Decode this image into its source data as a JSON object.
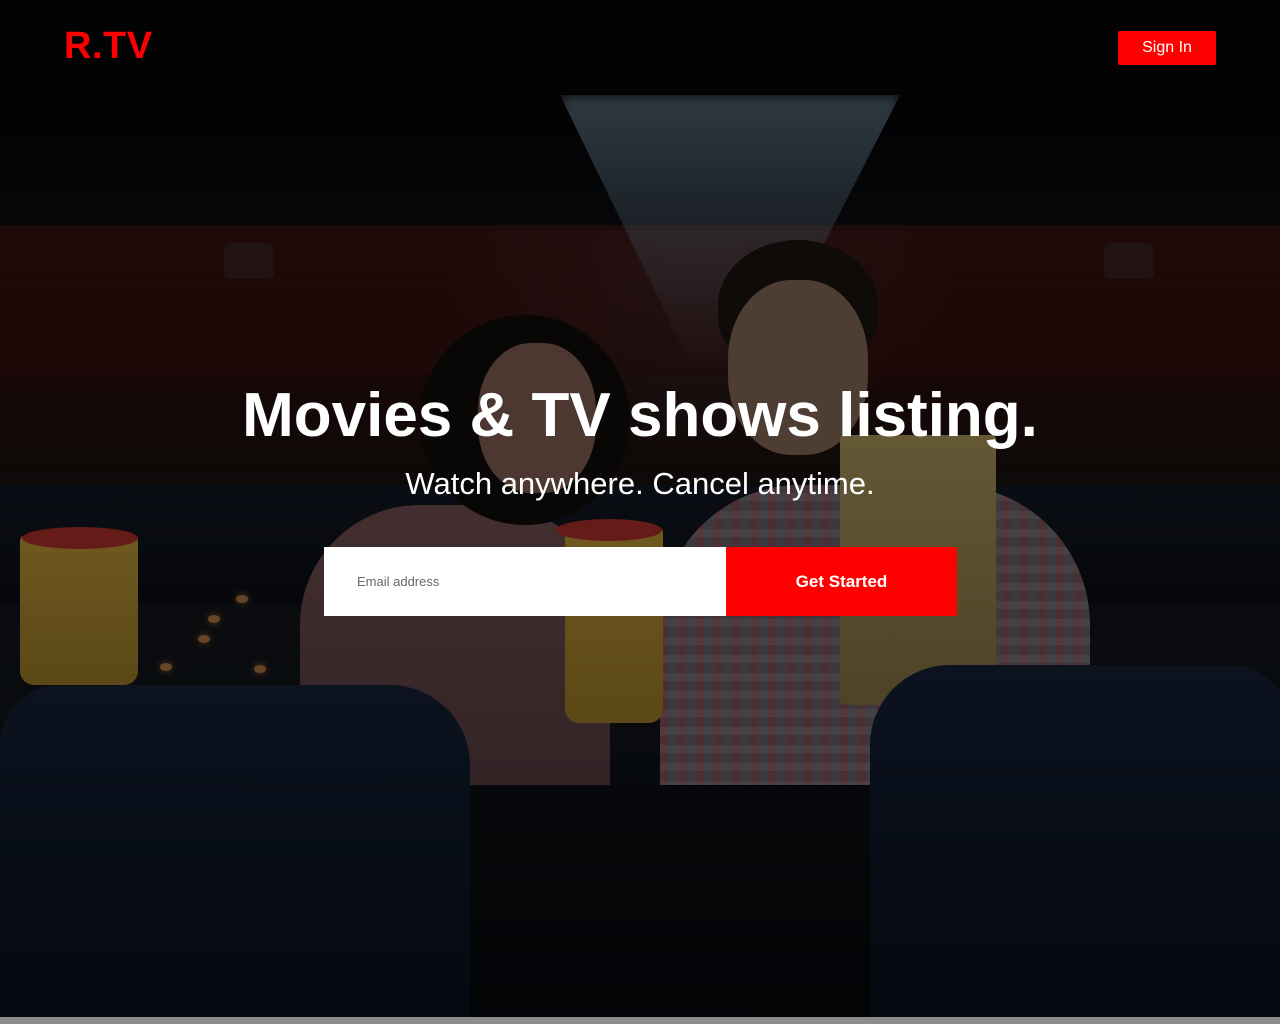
{
  "header": {
    "logo": "R.TV",
    "signin_label": "Sign In"
  },
  "hero": {
    "title": "Movies & TV shows listing.",
    "subtitle": "Watch anywhere. Cancel anytime.",
    "email_placeholder": "Email address",
    "cta_label": "Get Started",
    "background_image": "cinema-couple-photo"
  },
  "colors": {
    "brand": "#ff0000",
    "header_bg": "#030303",
    "text": "#ffffff"
  }
}
